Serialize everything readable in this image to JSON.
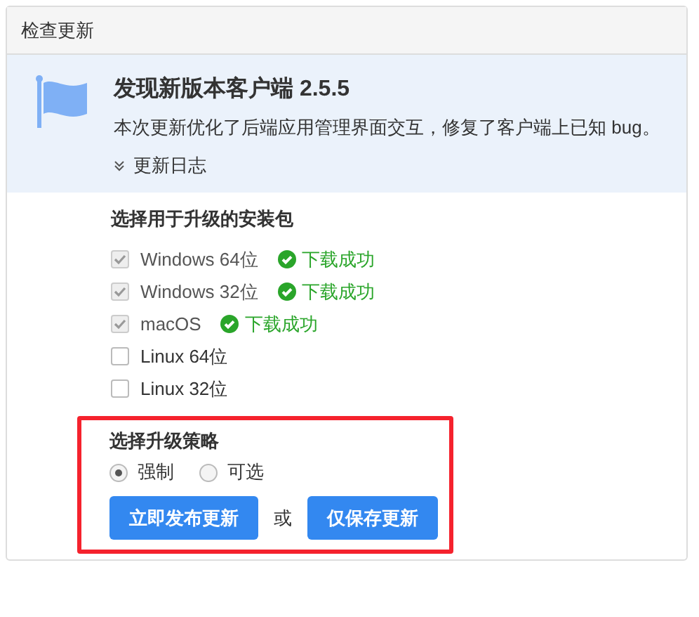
{
  "panel": {
    "title": "检查更新"
  },
  "notice": {
    "title": "发现新版本客户端 2.5.5",
    "description": "本次更新优化了后端应用管理界面交互，修复了客户端上已知 bug。",
    "changelog_link": "更新日志"
  },
  "packages": {
    "title": "选择用于升级的安装包",
    "items": [
      {
        "label": "Windows 64位",
        "checked": true,
        "disabled": true,
        "status": "下载成功"
      },
      {
        "label": "Windows 32位",
        "checked": true,
        "disabled": true,
        "status": "下载成功"
      },
      {
        "label": "macOS",
        "checked": true,
        "disabled": true,
        "status": "下载成功"
      },
      {
        "label": "Linux 64位",
        "checked": false,
        "disabled": false
      },
      {
        "label": "Linux 32位",
        "checked": false,
        "disabled": false
      }
    ]
  },
  "strategy": {
    "highlighted": true,
    "title": "选择升级策略",
    "options": [
      {
        "label": "强制",
        "selected": true
      },
      {
        "label": "可选",
        "selected": false
      }
    ],
    "buttons": [
      {
        "label": "立即发布更新"
      },
      {
        "label": "仅保存更新"
      }
    ],
    "separator": "或"
  }
}
